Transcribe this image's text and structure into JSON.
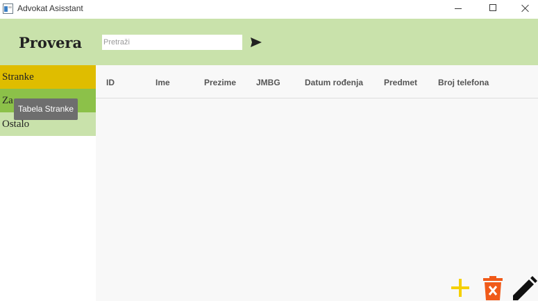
{
  "window": {
    "title": "Advokat Asisstant",
    "icon": "app-window-icon"
  },
  "header": {
    "brand": "Provera",
    "search": {
      "placeholder": "Pretraži",
      "value": ""
    },
    "send_icon": "send-arrow-icon"
  },
  "sidebar": {
    "items": [
      {
        "label": "Stranke",
        "color": "#dfbd00"
      },
      {
        "label": "Za",
        "color": "#8cc149"
      },
      {
        "label": "Ostalo",
        "color": "#c9e2ab"
      }
    ]
  },
  "tooltip": {
    "text": "Tabela Stranke"
  },
  "table": {
    "columns": [
      "ID",
      "Ime",
      "Prezime",
      "JMBG",
      "Datum rođenja",
      "Predmet",
      "Broj telefona"
    ],
    "rows": []
  },
  "actions": {
    "add": {
      "icon": "plus-icon",
      "color": "#f5d000"
    },
    "delete": {
      "icon": "trash-icon",
      "color": "#f05a19"
    },
    "edit": {
      "icon": "pencil-icon",
      "color": "#111111"
    }
  },
  "colors": {
    "header_bg": "#c9e2ab",
    "main_bg": "#f8f8f8"
  }
}
